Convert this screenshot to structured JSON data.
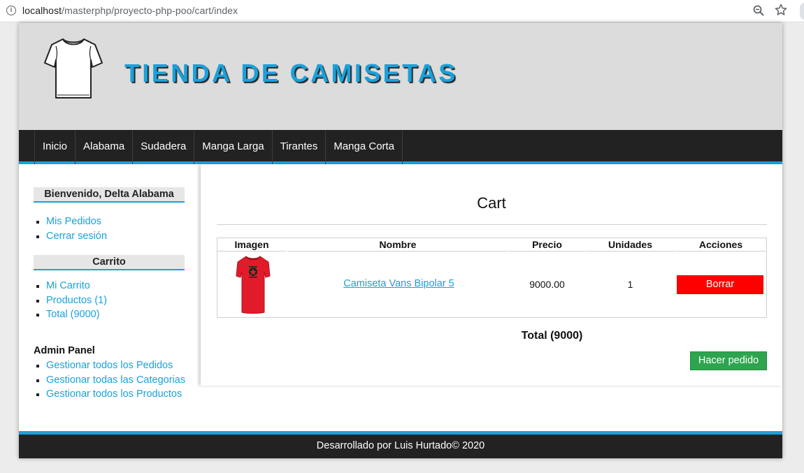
{
  "browser": {
    "url_host": "localhost",
    "url_path": "/masterphp/proyecto-php-poo/cart/index",
    "icons": [
      "info-icon",
      "zoom-icon",
      "star-icon"
    ]
  },
  "header": {
    "title": "TIENDA DE CAMISETAS",
    "logo_icon": "tshirt-icon"
  },
  "menu": {
    "items": [
      "Inicio",
      "Alabama",
      "Sudadera",
      "Manga Larga",
      "Tirantes",
      "Manga Corta"
    ]
  },
  "sidebar": {
    "welcome": "Bienvenido, Delta Alabama",
    "user_links": [
      "Mis Pedidos",
      "Cerrar sesión"
    ],
    "cart_title": "Carrito",
    "cart_links": [
      "Mi Carrito",
      "Productos (1)",
      "Total (9000)"
    ],
    "admin_title": "Admin Panel",
    "admin_links": [
      "Gestionar todos los Pedidos",
      "Gestionar todas las Categorias",
      "Gestionar todos los Productos"
    ]
  },
  "cart": {
    "title": "Cart",
    "columns": [
      "Imagen",
      "Nombre",
      "Precio",
      "Unidades",
      "Acciones"
    ],
    "rows": [
      {
        "image": "red t-shirt",
        "name": "Camiseta Vans Bipolar 5",
        "price": "9000.00",
        "units": "1",
        "action": "Borrar"
      }
    ],
    "total": "Total (9000)",
    "order_button": "Hacer pedido"
  },
  "footer": {
    "text": "Desarrollado por Luis Hurtado© 2020"
  },
  "colors": {
    "accent": "#1aa1db",
    "dark": "#222222",
    "delete": "#ff0000",
    "order": "#2ea44f"
  }
}
